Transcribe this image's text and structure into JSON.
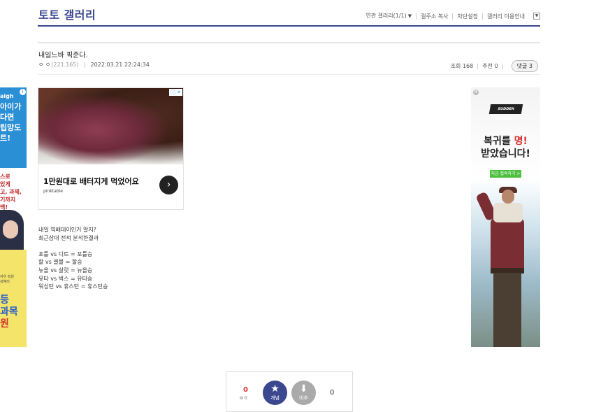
{
  "header": {
    "gallery_title": "토토 갤러리",
    "nav": {
      "related": "연관 갤러리(1/1)",
      "copy_url": "갤주소 복사",
      "block_settings": "차단설정",
      "guide": "갤러리 이용안내"
    }
  },
  "post": {
    "title": "내일느바 픽준다.",
    "author": "ㅇ ㅇ",
    "ip": "(221.165)",
    "datetime": "2022.03.21 22:24:34",
    "views_label": "조회",
    "views": "168",
    "recommend_label": "추천",
    "recommend": "0",
    "comments_label": "댓글",
    "comments": "3",
    "body_lines": [
      "내일 역배데이인거 알지?",
      "최근상대 전적 분석한결과",
      "",
      "포틀 vs 디트 = 포틀승",
      "할 vs 클블 = 할승",
      "뉴올 vs 살럿 = 뉴올승",
      "유타 vs 벅스 = 유타승",
      "워싱턴 vs 휴스턴 = 휴스턴승"
    ]
  },
  "ads": {
    "center": {
      "headline": "1만원대로 배터지게 먹었어요",
      "brand": "pinktable",
      "arrow": "›"
    },
    "right": {
      "logo": "SUDDEN ATTACK",
      "line1_a": "복귀를 ",
      "line1_b": "명!",
      "line2": "받았습니다!",
      "cta": "지금 접속하기 >"
    },
    "left": {
      "brand": "aigh",
      "top_lines": [
        "아이가",
        "다면",
        "립망도",
        "트!"
      ],
      "panel_lines": [
        "스로",
        "있게",
        "고, 과제,",
        "기까지",
        "백!"
      ],
      "caption": "자우 회원\n강혜리",
      "bottom_lines": [
        "등",
        "과목",
        "원"
      ]
    }
  },
  "vote": {
    "up_count": "0",
    "fix_count": "0",
    "up_label": "개념",
    "down_label": "비추",
    "down_count": "0"
  }
}
